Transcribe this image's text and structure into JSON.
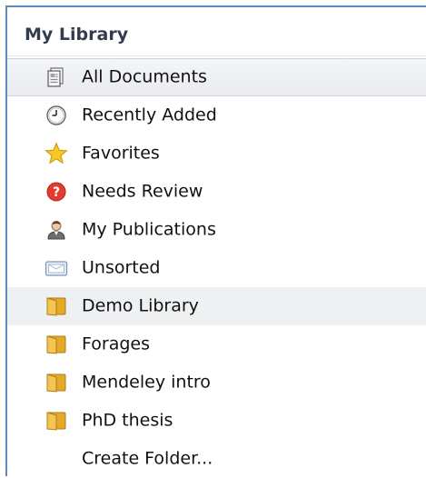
{
  "sidebar": {
    "title": "My Library",
    "items": [
      {
        "label": "All Documents",
        "icon": "documents-icon"
      },
      {
        "label": "Recently Added",
        "icon": "clock-icon"
      },
      {
        "label": "Favorites",
        "icon": "star-icon"
      },
      {
        "label": "Needs Review",
        "icon": "question-icon"
      },
      {
        "label": "My Publications",
        "icon": "person-icon"
      },
      {
        "label": "Unsorted",
        "icon": "tray-icon"
      },
      {
        "label": "Demo Library",
        "icon": "folder-icon"
      },
      {
        "label": "Forages",
        "icon": "folder-icon"
      },
      {
        "label": "Mendeley intro",
        "icon": "folder-icon"
      },
      {
        "label": "PhD thesis",
        "icon": "folder-icon"
      },
      {
        "label": "Create Folder..."
      }
    ]
  },
  "colors": {
    "border": "#5b8bc0",
    "folder": "#e8b23a",
    "star": "#f5c518",
    "needs_review": "#e53b30"
  }
}
